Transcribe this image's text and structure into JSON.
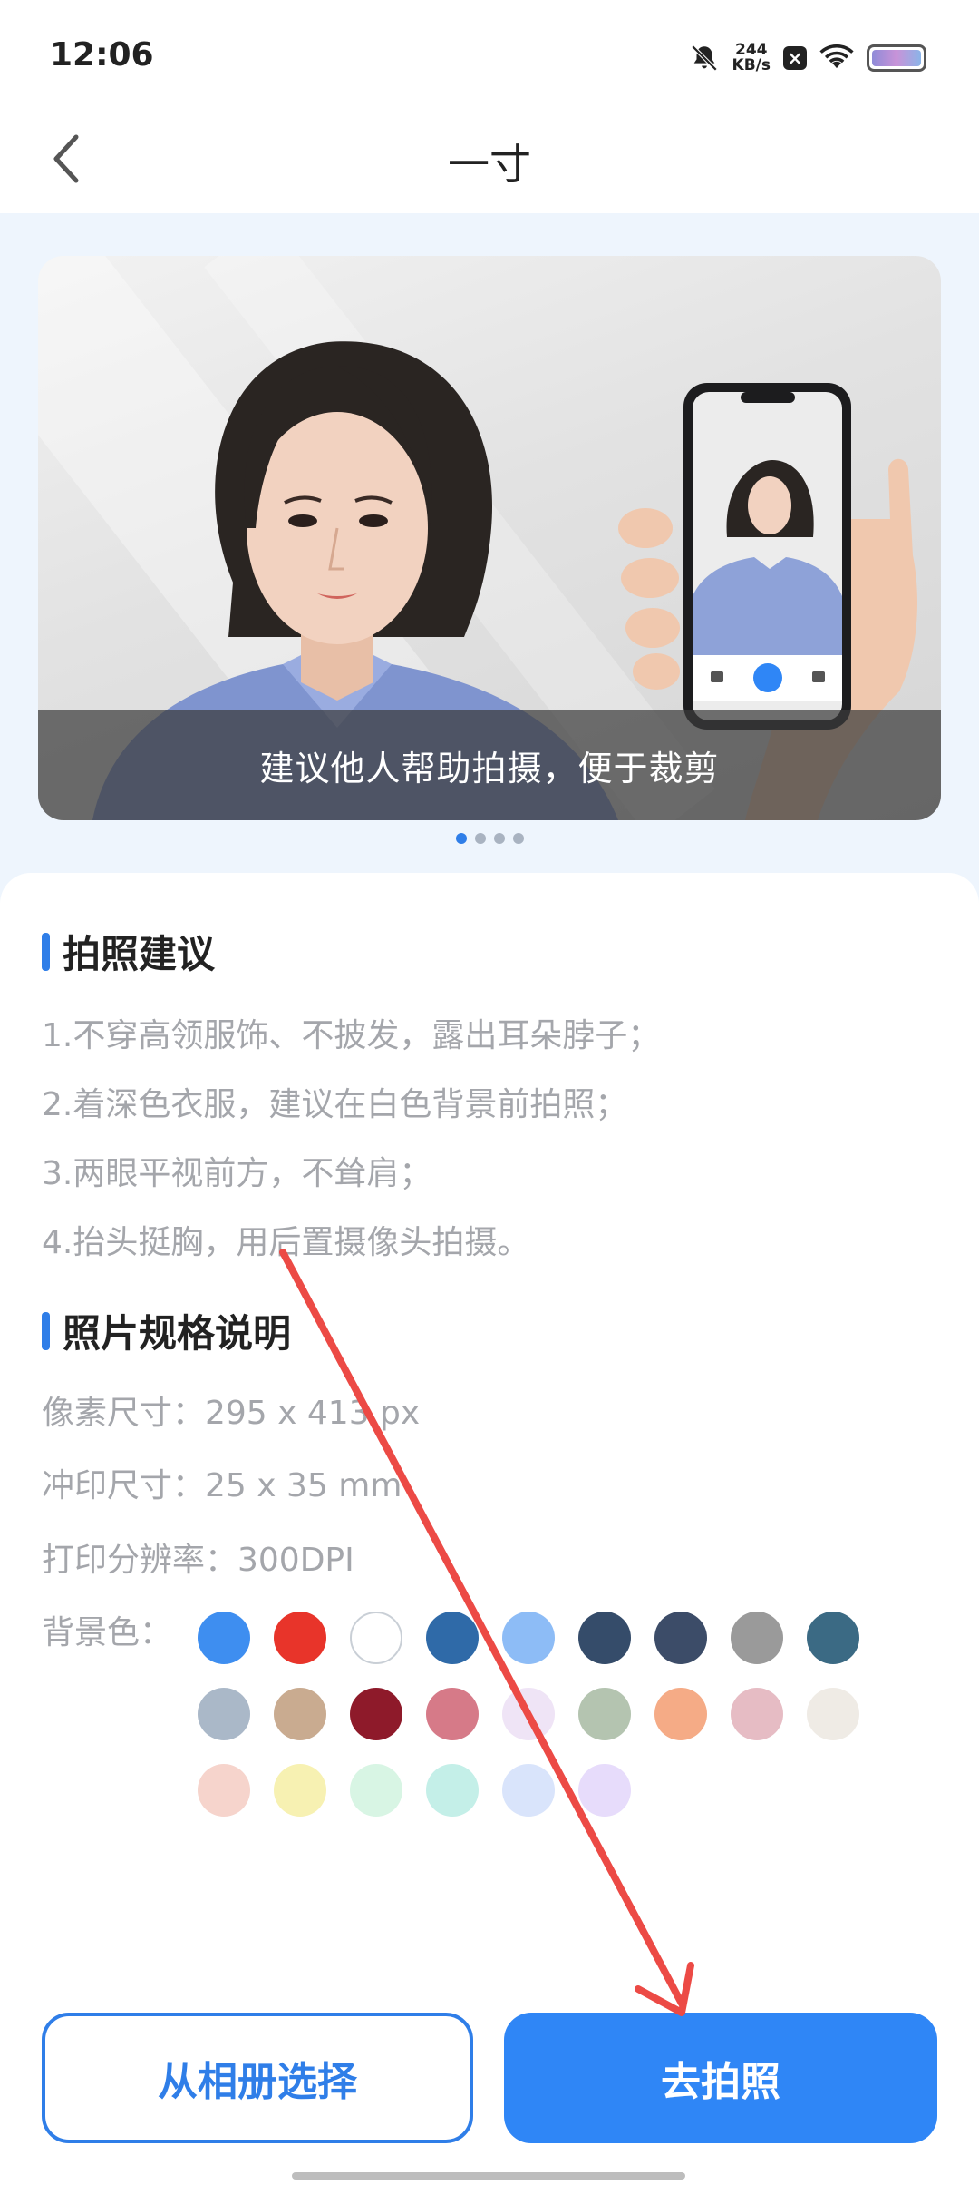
{
  "status_bar": {
    "time": "12:06",
    "net_speed_value": "244",
    "net_speed_unit": "KB/s",
    "icons": [
      "mute-icon",
      "close-box-icon",
      "wifi-icon",
      "battery-icon"
    ]
  },
  "nav": {
    "title": "一寸",
    "back_icon": "chevron-left-icon"
  },
  "carousel": {
    "caption": "建议他人帮助拍摄，便于裁剪",
    "page_count": 4,
    "active_index": 0
  },
  "tips": {
    "title": "拍照建议",
    "items": [
      "1.不穿高领服饰、不披发，露出耳朵脖子；",
      "2.着深色衣服，建议在白色背景前拍照；",
      "3.两眼平视前方，不耸肩；",
      "4.抬头挺胸，用后置摄像头拍摄。"
    ]
  },
  "spec": {
    "title": "照片规格说明",
    "pixel_size": "像素尺寸：295 x 413 px",
    "print_size": "冲印尺寸：25 x 35 mm",
    "print_resolution": "打印分辨率：300DPI",
    "bg_label": "背景色："
  },
  "swatches": [
    [
      "#3e8ef0",
      "#e8342a",
      "#ffffff",
      "#2f6aa8",
      "#8dbcf6",
      "#354c6a",
      "#3c4c68",
      "#9a9a9a",
      "#3b6a84"
    ],
    [
      "#aab8c8",
      "#c9ab90",
      "#8e1a2a",
      "#d67a88",
      "#efe4f6",
      "#b4c4b0",
      "#f5ab86",
      "#e6bcc4",
      "#efebe5"
    ],
    [
      "#f6d4cc",
      "#f7f1b2",
      "#d8f5e4",
      "#c4efe8",
      "#d9e4fb",
      "#e7dcfb"
    ]
  ],
  "buttons": {
    "album": "从相册选择",
    "shoot": "去拍照"
  },
  "colors": {
    "accent": "#2f7ee8",
    "annotation_arrow": "#ec4a45"
  }
}
